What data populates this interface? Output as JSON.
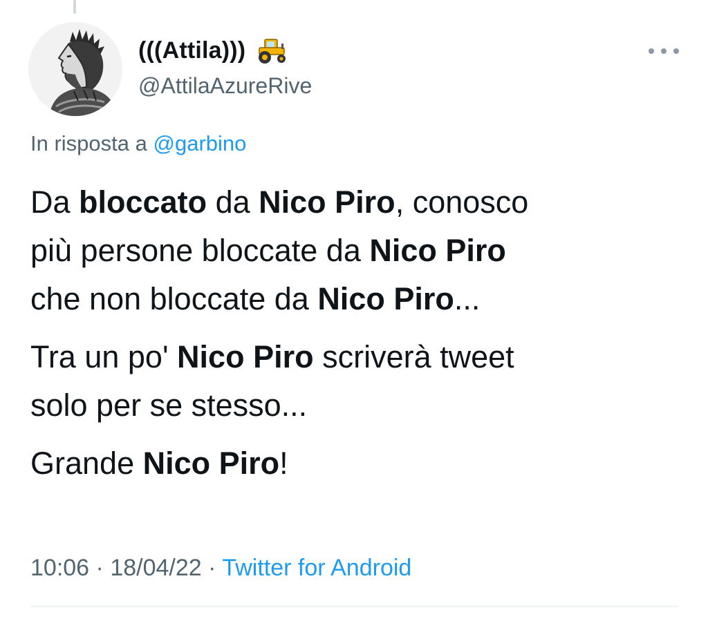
{
  "tweet": {
    "author": {
      "display_name": "(((Attila)))",
      "name_emoji": "tractor",
      "handle": "@AttilaAzureRive",
      "avatar": "profile-engraving"
    },
    "more_icon": "more-horizontal-icon",
    "reply_context": {
      "prefix": "In risposta a",
      "mention": "@garbino"
    },
    "body": {
      "p1": {
        "s1": "Da ",
        "b1": "bloccato",
        "s2": " da ",
        "b2": "Nico Piro",
        "s3": ", conosco",
        "s4": "più persone bloccate da ",
        "b3": "Nico Piro",
        "s5": "che non bloccate da ",
        "b4": "Nico Piro",
        "s6": "..."
      },
      "p2": {
        "s1": "Tra un po' ",
        "b1": "Nico Piro",
        "s2": " scriverà tweet",
        "s3": "solo per se stesso..."
      },
      "p3": {
        "s1": "Grande ",
        "b1": "Nico Piro",
        "s2": "!"
      }
    },
    "meta": {
      "time": "10:06",
      "separator": "·",
      "date": "18/04/22",
      "source": "Twitter for Android"
    }
  },
  "colors": {
    "text": "#0f1419",
    "secondary": "#536471",
    "link": "#1d9bf0",
    "divider": "#eff3f4"
  }
}
